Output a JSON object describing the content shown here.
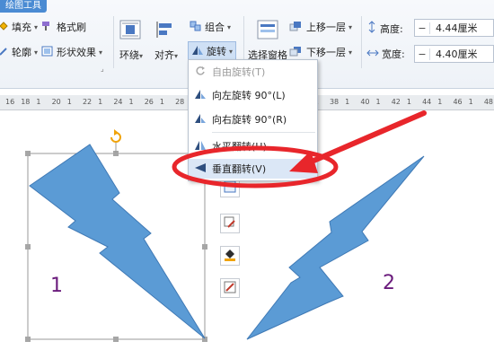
{
  "ribbon": {
    "tab_title": "绘图工具",
    "fill_label": "填充",
    "format_brush_label": "格式刷",
    "outline_label": "轮廓",
    "shape_effect_label": "形状效果",
    "wrap_label": "环绕",
    "align_label": "对齐",
    "group_label": "组合",
    "rotate_label": "旋转",
    "selection_pane_label": "选择窗格",
    "bring_forward_label": "上移一层",
    "send_backward_label": "下移一层",
    "height_label": "高度:",
    "height_value": "4.44厘米",
    "width_label": "宽度:",
    "width_value": "4.40厘米",
    "minus": "−"
  },
  "ruler": {
    "ticks": [
      "16",
      "18",
      "1",
      "20",
      "1",
      "22",
      "1",
      "24",
      "1",
      "26",
      "1",
      "28",
      "1",
      "30",
      "1",
      "32",
      "1",
      "34",
      "1",
      "36",
      "1",
      "38",
      "1",
      "40",
      "1",
      "42",
      "1",
      "44",
      "1",
      "46",
      "1",
      "48"
    ]
  },
  "menu": {
    "items": [
      {
        "label": "自由旋转(T)",
        "enabled": false
      },
      {
        "label": "向左旋转 90°(L)",
        "enabled": true
      },
      {
        "label": "向右旋转 90°(R)",
        "enabled": true
      },
      {
        "label": "水平翻转(H)",
        "enabled": true
      },
      {
        "label": "垂直翻转(V)",
        "enabled": true,
        "highlighted": true
      }
    ]
  },
  "canvas": {
    "shape1_label": "1",
    "shape2_label": "2"
  },
  "colors": {
    "bolt_fill": "#5b9bd5",
    "bolt_stroke": "#3f79b5",
    "annotation_red": "#e8262b",
    "label_purple": "#6a1b7c"
  }
}
